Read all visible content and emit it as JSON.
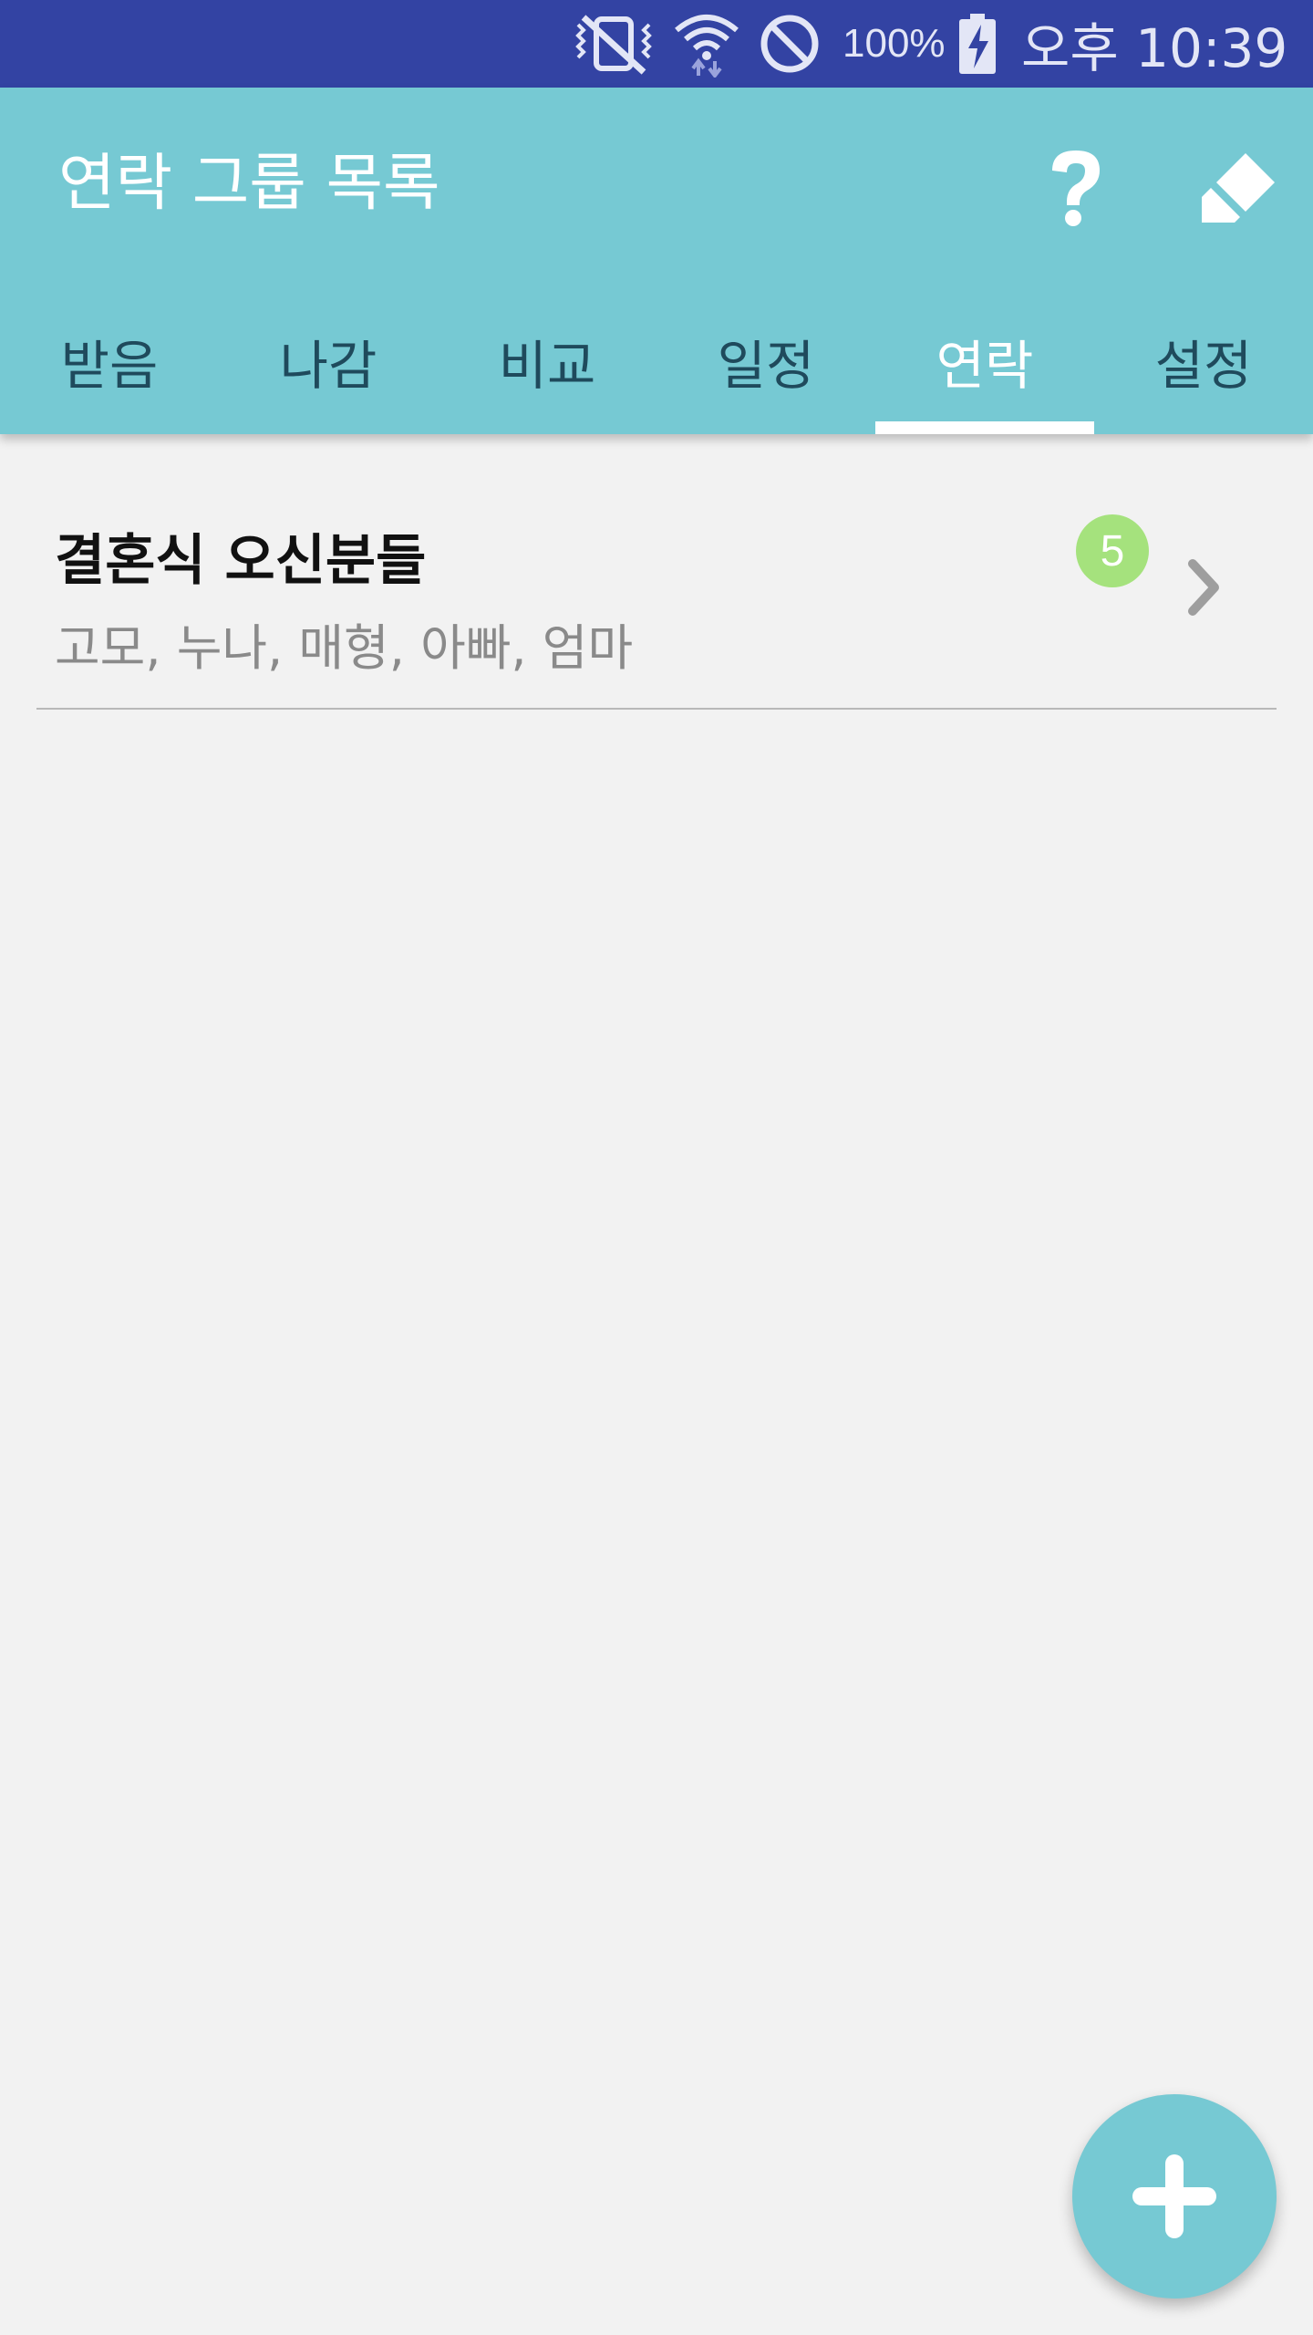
{
  "status_bar": {
    "battery_percent": "100%",
    "time": "오후 10:39",
    "icons": [
      "vibrate-off-icon",
      "wifi-icon",
      "do-not-disturb-icon",
      "battery-charging-icon"
    ]
  },
  "app_bar": {
    "title": "연락 그룹 목록",
    "actions": [
      "help-icon",
      "eraser-icon"
    ],
    "background_color": "#76c9d3"
  },
  "tabs": [
    {
      "label": "받음",
      "active": false
    },
    {
      "label": "나감",
      "active": false
    },
    {
      "label": "비교",
      "active": false
    },
    {
      "label": "일정",
      "active": false
    },
    {
      "label": "연락",
      "active": true
    },
    {
      "label": "설정",
      "active": false
    }
  ],
  "groups": [
    {
      "title": "결혼식 오신분들",
      "members": "고모, 누나, 매형, 아빠, 엄마",
      "count": "5",
      "badge_color": "#a5e27d"
    }
  ],
  "fab": {
    "icon": "plus-icon"
  }
}
